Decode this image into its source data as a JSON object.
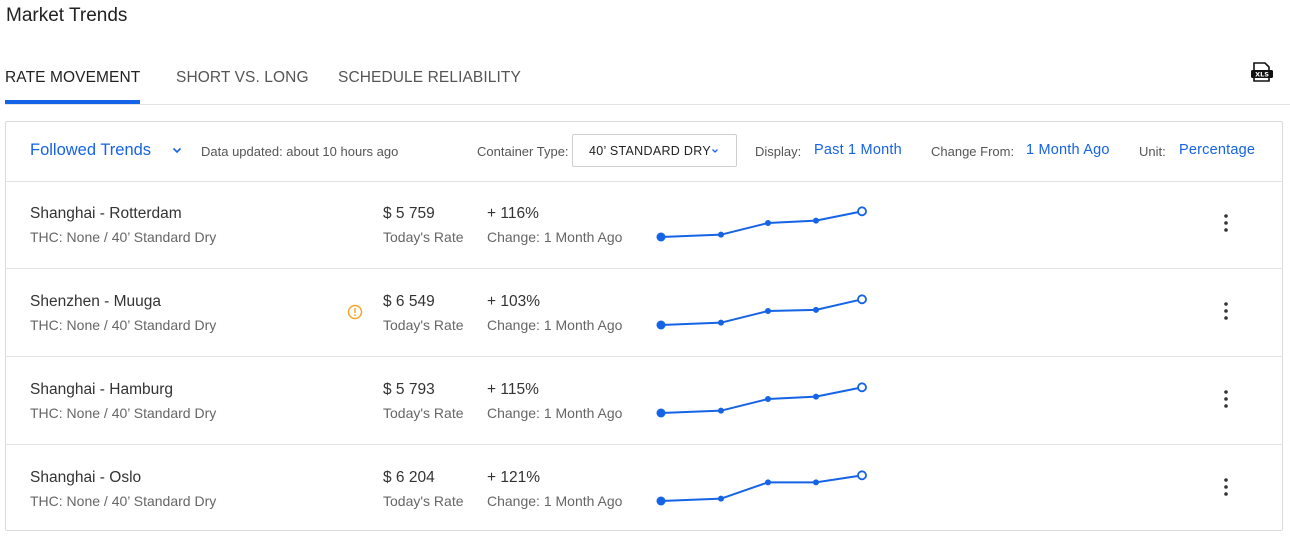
{
  "page": {
    "title": "Market Trends"
  },
  "tabs": [
    {
      "label": "RATE MOVEMENT",
      "active": true
    },
    {
      "label": "SHORT VS. LONG",
      "active": false
    },
    {
      "label": "SCHEDULE RELIABILITY",
      "active": false
    }
  ],
  "export": {
    "icon": "xls-file-icon",
    "badge": "XLS"
  },
  "toolbar": {
    "followed_label": "Followed Trends",
    "updated_text": "Data updated: about 10 hours ago",
    "container_type_label": "Container Type:",
    "container_type_value": "40’ STANDARD DRY",
    "display_label": "Display:",
    "display_value": "Past 1 Month",
    "change_from_label": "Change From:",
    "change_from_value": "1 Month Ago",
    "unit_label": "Unit:",
    "unit_value": "Percentage"
  },
  "colors": {
    "accent": "#1563e6",
    "warning": "#f5a623"
  },
  "rows": [
    {
      "route": "Shanghai - Rotterdam",
      "thc": "THC: None / 40’ Standard Dry",
      "rate": "$ 5 759",
      "rate_label": "Today's Rate",
      "change": "+ 116%",
      "change_label": "Change: 1 Month Ago",
      "warning": false,
      "trend": [
        0,
        1,
        6,
        7,
        11
      ]
    },
    {
      "route": "Shenzhen - Muuga",
      "thc": "THC: None / 40’ Standard Dry",
      "rate": "$ 6 549",
      "rate_label": "Today's Rate",
      "change": "+ 103%",
      "change_label": "Change: 1 Month Ago",
      "warning": true,
      "trend": [
        0,
        1,
        6,
        6.5,
        11
      ]
    },
    {
      "route": "Shanghai - Hamburg",
      "thc": "THC: None / 40’ Standard Dry",
      "rate": "$ 5 793",
      "rate_label": "Today's Rate",
      "change": "+ 115%",
      "change_label": "Change: 1 Month Ago",
      "warning": false,
      "trend": [
        0,
        1,
        6,
        7,
        11
      ]
    },
    {
      "route": "Shanghai - Oslo",
      "thc": "THC: None / 40’ Standard Dry",
      "rate": "$ 6 204",
      "rate_label": "Today's Rate",
      "change": "+ 121%",
      "change_label": "Change: 1 Month Ago",
      "warning": false,
      "trend": [
        0,
        1,
        8,
        8,
        11
      ]
    }
  ]
}
